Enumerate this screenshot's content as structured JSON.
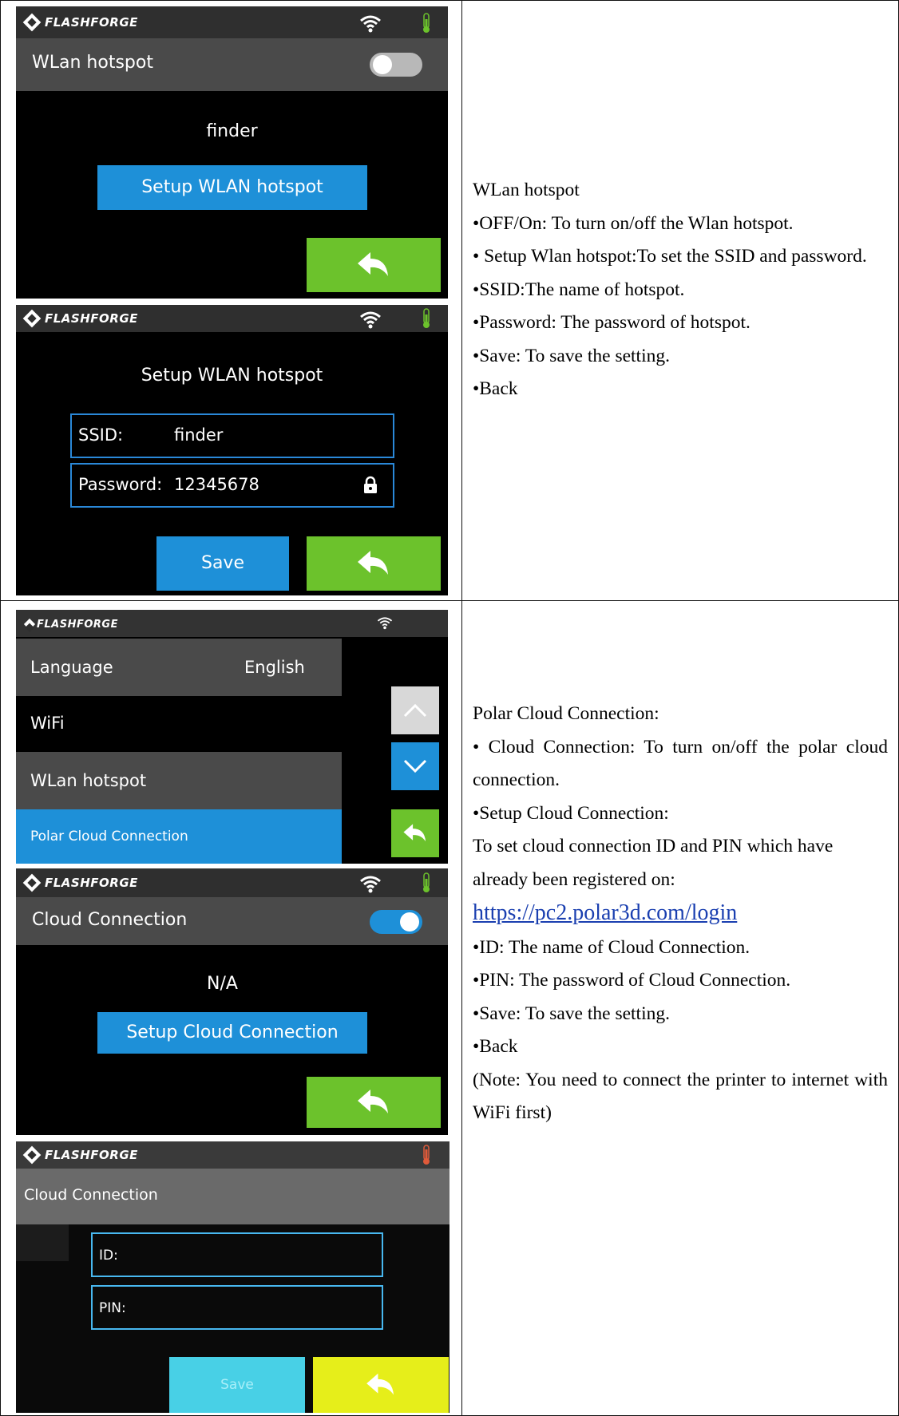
{
  "brand": "FLASHFORGE",
  "screen1": {
    "header": "WLan hotspot",
    "ssid": "finder",
    "setup_button": "Setup WLAN hotspot"
  },
  "screen2": {
    "title": "Setup WLAN hotspot",
    "ssid_label": "SSID:",
    "ssid_value": "finder",
    "password_label": "Password:",
    "password_value": "12345678",
    "save_button": "Save"
  },
  "screen3": {
    "items": [
      {
        "label": "Language",
        "value": "English"
      },
      {
        "label": "WiFi"
      },
      {
        "label": "WLan hotspot"
      },
      {
        "label": "Polar Cloud Connection"
      }
    ]
  },
  "screen4": {
    "header": "Cloud Connection",
    "status": "N/A",
    "setup_button": "Setup Cloud Connection"
  },
  "screen5": {
    "header": "Cloud Connection",
    "id_label": "ID:",
    "pin_label": "PIN:",
    "save_button": "Save"
  },
  "desc1": {
    "title": "WLan hotspot",
    "line1": "•OFF/On: To turn on/off the Wlan hotspot.",
    "line2": "• Setup Wlan hotspot:To set the SSID and password.",
    "line3": "•SSID:The name of hotspot.",
    "line4": "•Password: The password of hotspot.",
    "line5": "•Save: To save the setting.",
    "line6": "•Back"
  },
  "desc2": {
    "title": "Polar Cloud Connection:",
    "line1": "• Cloud Connection: To turn on/off the polar cloud connection.",
    "line2": "•Setup Cloud Connection:",
    "line3": "To set cloud connection ID and PIN which have already been registered on:",
    "link": "https://pc2.polar3d.com/login",
    "line4": "•ID: The name of Cloud Connection.",
    "line5": "•PIN: The password of Cloud Connection.",
    "line6": "•Save: To save the setting.",
    "line7": "•Back",
    "note": "(Note: You need to connect the printer to internet with WiFi first)"
  },
  "colors": {
    "blue": "#1e90d8",
    "green": "#6cc22c",
    "cyan": "#48d0e6",
    "yellow": "#e6ee1a"
  }
}
